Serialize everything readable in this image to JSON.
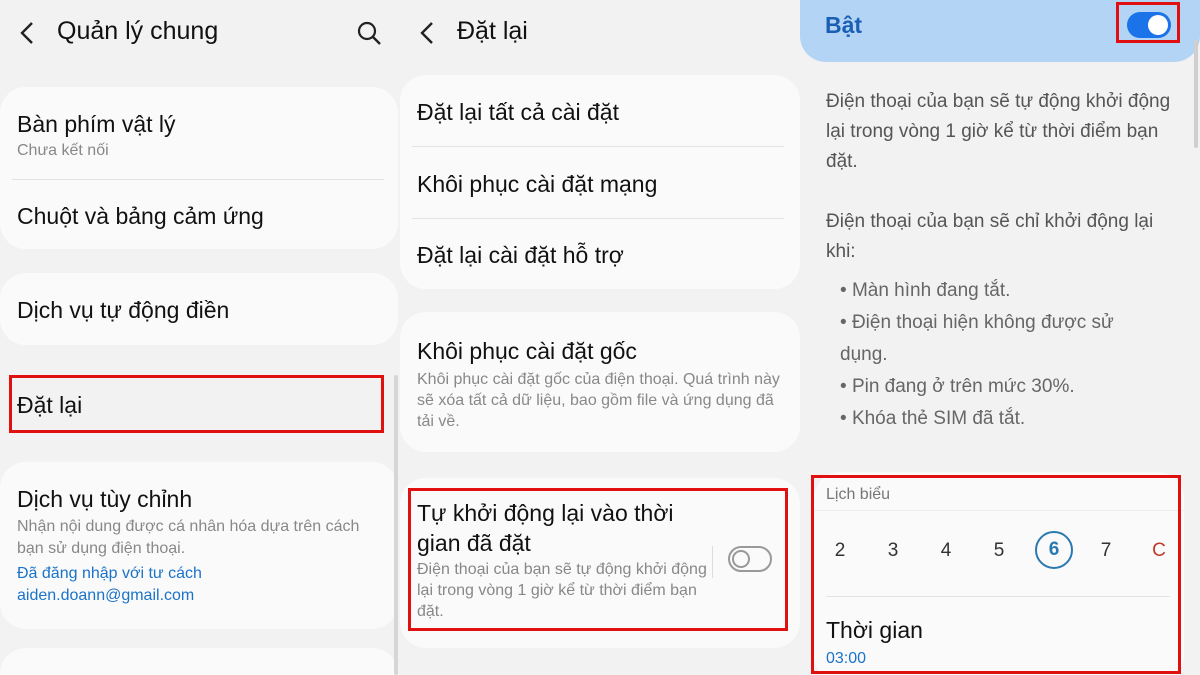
{
  "panel1": {
    "title": "Quản lý chung",
    "items": {
      "keyboard": {
        "label": "Bàn phím vật lý",
        "sub": "Chưa kết nối"
      },
      "mouse": {
        "label": "Chuột và bảng cảm ứng"
      },
      "autofill": {
        "label": "Dịch vụ tự động điền"
      },
      "reset": {
        "label": "Đặt lại"
      },
      "custom": {
        "label": "Dịch vụ tùy chỉnh",
        "sub": "Nhận nội dung được cá nhân hóa dựa trên cách bạn sử dụng điện thoại.",
        "account_note": "Đã đăng nhập với tư cách",
        "email": "aiden.doann@gmail.com"
      }
    }
  },
  "panel2": {
    "title": "Đặt lại",
    "items": {
      "reset_all": {
        "label": "Đặt lại tất cả cài đặt"
      },
      "network": {
        "label": "Khôi phục cài đặt mạng"
      },
      "accessibility": {
        "label": "Đặt lại cài đặt hỗ trợ"
      },
      "factory": {
        "label": "Khôi phục cài đặt gốc",
        "sub": "Khôi phục cài đặt gốc của điện thoại. Quá trình này sẽ xóa tất cả dữ liệu, bao gồm file và ứng dụng đã tải về."
      },
      "auto_restart": {
        "label": "Tự khởi động lại vào thời gian đã đặt",
        "sub": "Điện thoại của bạn sẽ tự động khởi động lại trong vòng 1 giờ kể từ thời điểm bạn đặt.",
        "enabled": false
      }
    }
  },
  "panel3": {
    "switch_label": "Bật",
    "switch_on": true,
    "para1": "Điện thoại của bạn sẽ tự động khởi động lại trong vòng 1 giờ kể từ thời điểm bạn đặt.",
    "para2": "Điện thoại của bạn sẽ chỉ khởi động lại khi:",
    "bullets": [
      "Màn hình đang tắt.",
      "Điện thoại hiện không được sử dụng.",
      "Pin đang ở trên mức 30%.",
      "Khóa thẻ SIM đã tắt."
    ],
    "schedule_label": "Lịch biểu",
    "days": [
      "2",
      "3",
      "4",
      "5",
      "6",
      "7",
      "C"
    ],
    "selected_day": "6",
    "time_label": "Thời gian",
    "time_value": "03:00"
  },
  "colors": {
    "accent": "#1a73e8",
    "highlight_box": "#e01010",
    "top_bar": "#b3d4f4",
    "link": "#1a73c9"
  },
  "icons": [
    "back-arrow-icon",
    "search-icon"
  ]
}
